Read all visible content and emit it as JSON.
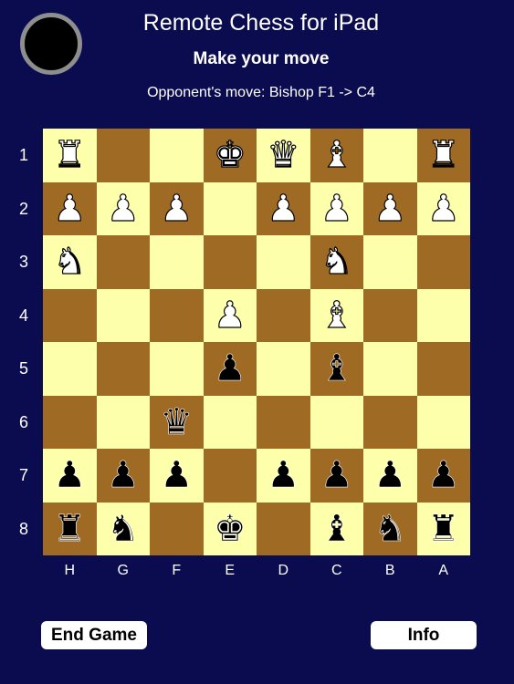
{
  "header": {
    "title": "Remote Chess for iPad",
    "status": "Make your move",
    "last_move": "Opponent's move: Bishop F1 -> C4",
    "turn_color": "#000000"
  },
  "board": {
    "light_color": "#feffaa",
    "dark_color": "#9f6a24",
    "rank_labels": [
      "1",
      "2",
      "3",
      "4",
      "5",
      "6",
      "7",
      "8"
    ],
    "file_labels": [
      "H",
      "G",
      "F",
      "E",
      "D",
      "C",
      "B",
      "A"
    ],
    "rows": [
      [
        "wR",
        "",
        "",
        "wK",
        "wQ",
        "wB",
        "",
        "wR"
      ],
      [
        "wP",
        "wP",
        "wP",
        "",
        "wP",
        "wP",
        "wP",
        "wP"
      ],
      [
        "wN",
        "",
        "",
        "",
        "",
        "wN",
        "",
        ""
      ],
      [
        "",
        "",
        "",
        "wP",
        "",
        "wB",
        "",
        ""
      ],
      [
        "",
        "",
        "",
        "bP",
        "",
        "bB",
        "",
        ""
      ],
      [
        "",
        "",
        "bQ",
        "",
        "",
        "",
        "",
        ""
      ],
      [
        "bP",
        "bP",
        "bP",
        "",
        "bP",
        "bP",
        "bP",
        "bP"
      ],
      [
        "bR",
        "bN",
        "",
        "bK",
        "",
        "bB",
        "bN",
        "bR"
      ]
    ]
  },
  "buttons": {
    "end_game": "End Game",
    "info": "Info"
  }
}
